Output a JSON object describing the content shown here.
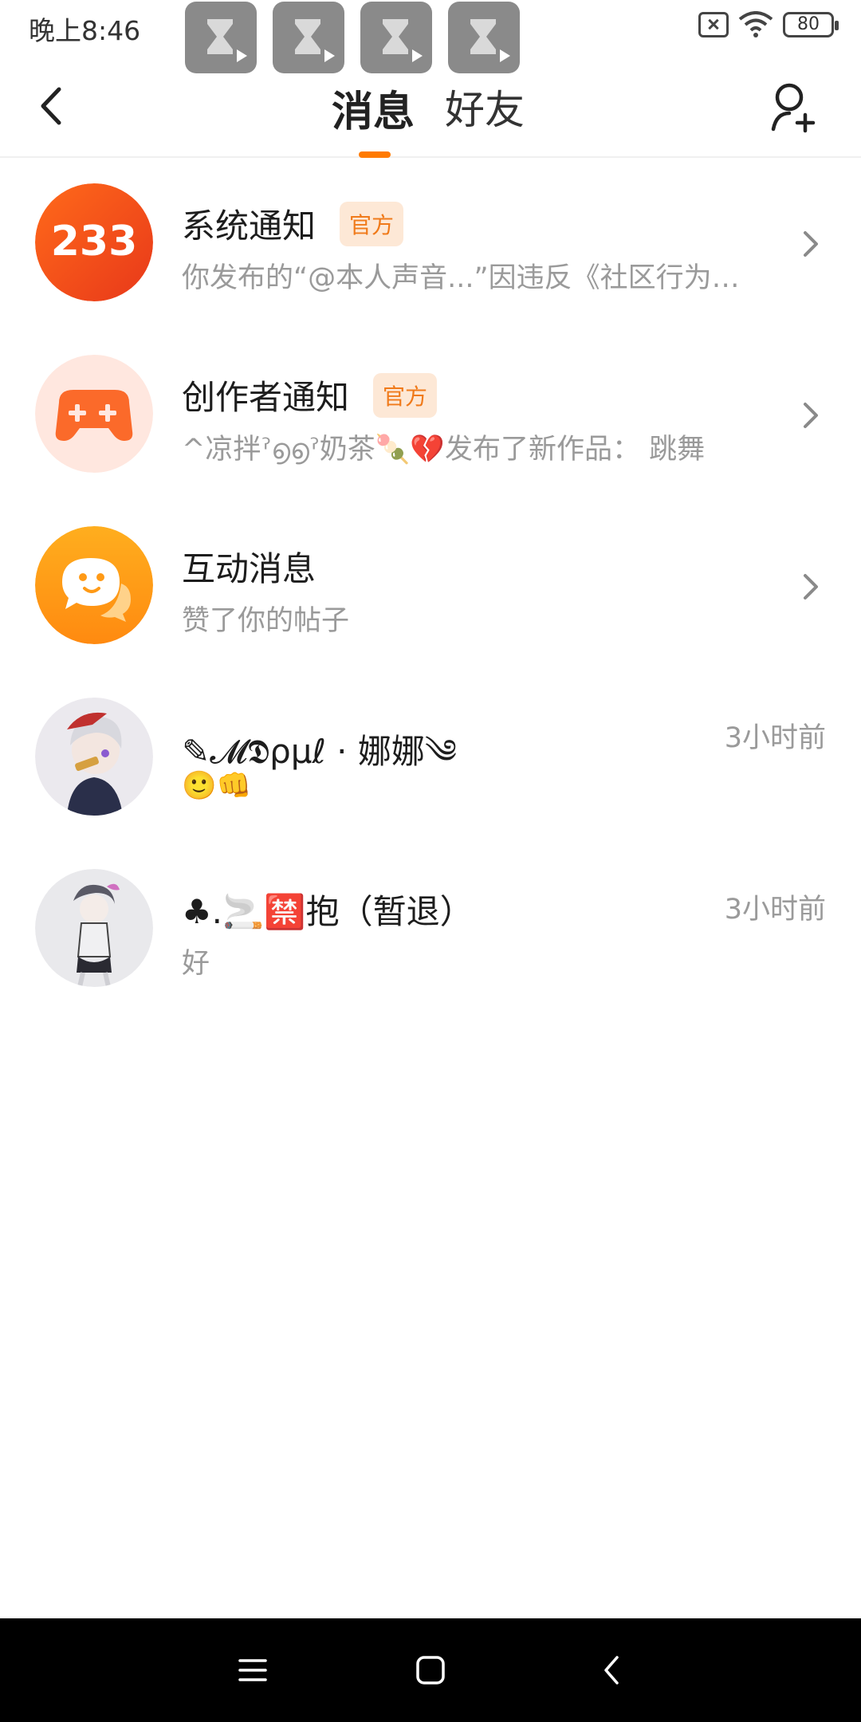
{
  "status_bar": {
    "time": "晚上8:46",
    "battery": "80",
    "icons": [
      "hourglass-app-icon",
      "hourglass-app-icon",
      "hourglass-app-icon",
      "hourglass-app-icon",
      "sim-off-icon",
      "wifi-icon",
      "battery-icon"
    ]
  },
  "header": {
    "tabs": [
      {
        "label": "消息",
        "active": true
      },
      {
        "label": "好友",
        "active": false
      }
    ],
    "accent_color": "#ff7a00"
  },
  "messages": [
    {
      "title": "系统通知",
      "badge": "官方",
      "subtitle": "你发布的“@本人声音...”因违反《社区行为规范》",
      "avatar_text": "233",
      "avatar_icon": "233-logo-icon",
      "avatar_color": "#f24a1a"
    },
    {
      "title": "创作者通知",
      "badge": "官方",
      "subtitle": "^凉拌ˀ൭൭ˀ奶茶🍡💔发布了新作品： 跳舞",
      "avatar_icon": "gamepad-icon",
      "avatar_color": "#ffe7df"
    },
    {
      "title": "互动消息",
      "subtitle": "赞了你的帖子",
      "avatar_icon": "chat-bubble-icon",
      "avatar_color": "#ff9a16"
    },
    {
      "title": "✎𝓜𝕯ρμℓ · 娜娜༄",
      "subtitle": "🙂👊",
      "time": "3小时前",
      "avatar_icon": "user-avatar"
    },
    {
      "title": "♣.🚬🈲抱（暂退）",
      "subtitle": "好",
      "time": "3小时前",
      "avatar_icon": "user-avatar"
    }
  ]
}
